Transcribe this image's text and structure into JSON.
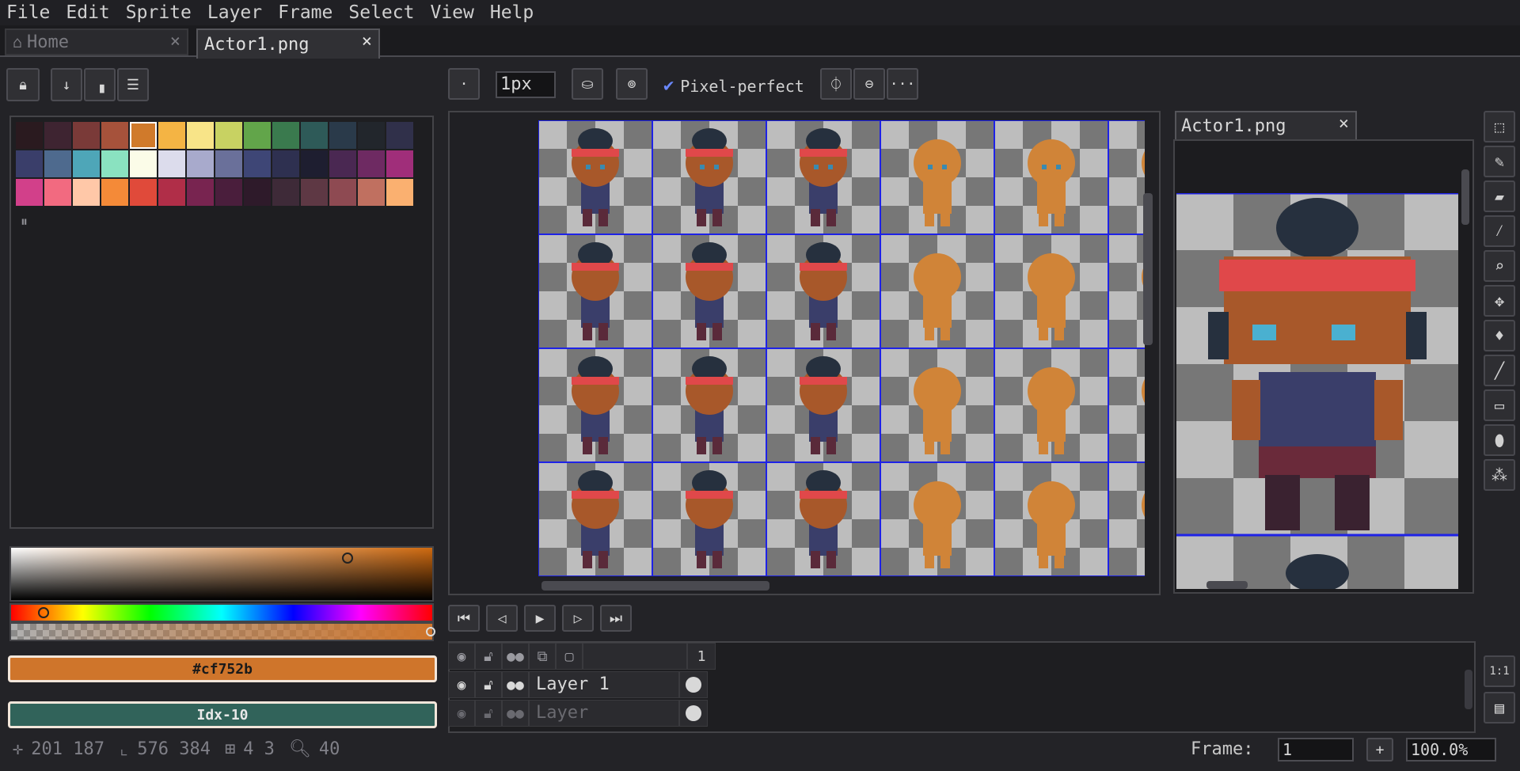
{
  "menu": [
    "File",
    "Edit",
    "Sprite",
    "Layer",
    "Frame",
    "Select",
    "View",
    "Help"
  ],
  "tabs": {
    "home": "Home",
    "active": "Actor1.png",
    "close": "×"
  },
  "toolbar": {
    "brush_size": "1px",
    "pixel_perfect": "Pixel-perfect",
    "more": "···",
    "brush_dot": "·"
  },
  "palette": {
    "rows": [
      [
        "#2a1a1f",
        "#3e2431",
        "#7a3a38",
        "#a6523b",
        "#d07a2b",
        "#f4b444",
        "#f8e488",
        "#c8d262",
        "#62a54a",
        "#3a7a4e",
        "#2e5a58",
        "#2a3a4a",
        "#22262c",
        "#30304a"
      ],
      [
        "#3a3e6a",
        "#4e6a8e",
        "#4ea6b8",
        "#8ae2c0",
        "#fbfce8",
        "#dcdcec",
        "#a8aacc",
        "#6a709a",
        "#3e4676",
        "#2e3050",
        "#1e1e30",
        "#4a2852",
        "#6e2a62",
        "#a02e7a"
      ],
      [
        "#d2408a",
        "#f26a80",
        "#ffc8a8",
        "#f48a38",
        "#e04a3a",
        "#b02e48",
        "#782450",
        "#4a1e3c",
        "#2e1a2a",
        "#3e2a38",
        "#5e3844",
        "#8e4a52",
        "#c07060",
        "#fab070"
      ]
    ],
    "selected_index": 4
  },
  "color": {
    "hex": "#cf752b",
    "index_label": "Idx-10",
    "fg": "#cf752b",
    "idx_color": "#31635a"
  },
  "status": {
    "cursor": "201 187",
    "size": "576 384",
    "grid": "4 3",
    "zoom": "40",
    "frame_label": "Frame:",
    "frame_value": "1",
    "zoom_value": "100.0%",
    "plus": "+"
  },
  "preview": {
    "tab": "Actor1.png",
    "close": "×"
  },
  "layers": {
    "frame_number": "1",
    "rows": [
      {
        "name": "Layer 1"
      },
      {
        "name": "Layer"
      }
    ]
  },
  "timeline_buttons": [
    "first-frame",
    "prev-frame",
    "play",
    "next-frame",
    "last-frame"
  ],
  "side_buttons": {
    "one_to_one": "1:1"
  },
  "colors": {
    "bg": "#232327",
    "accent": "#cf752b",
    "grid": "#1e22e6"
  }
}
